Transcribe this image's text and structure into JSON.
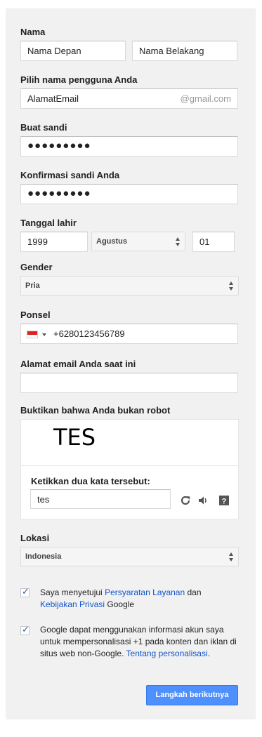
{
  "name": {
    "label": "Nama",
    "first_name": "Nama Depan",
    "last_name": "Nama Belakang"
  },
  "username": {
    "label": "Pilih nama pengguna Anda",
    "value": "AlamatEmail",
    "suffix": "@gmail.com"
  },
  "password": {
    "label": "Buat sandi",
    "value": "●●●●●●●●●"
  },
  "confirm_password": {
    "label": "Konfirmasi sandi Anda",
    "value": "●●●●●●●●●"
  },
  "birthday": {
    "label": "Tanggal lahir",
    "year": "1999",
    "month": "Agustus",
    "day": "01"
  },
  "gender": {
    "label": "Gender",
    "value": "Pria"
  },
  "phone": {
    "label": "Ponsel",
    "value": "+6280123456789"
  },
  "current_email": {
    "label": "Alamat email Anda saat ini",
    "value": ""
  },
  "captcha": {
    "label": "Buktikan bahwa Anda bukan robot",
    "word": "TES",
    "prompt": "Ketikkan dua kata tersebut:",
    "input_value": "tes"
  },
  "location": {
    "label": "Lokasi",
    "value": "Indonesia"
  },
  "terms": {
    "text_before": "Saya menyetujui ",
    "tos_link": "Persyaratan Layanan",
    "text_middle": " dan ",
    "privacy_link": "Kebijakan Privasi",
    "text_after": " Google"
  },
  "personalize": {
    "text": "Google dapat menggunakan informasi akun saya untuk mempersonalisasi +1 pada konten dan iklan di situs web non-Google. ",
    "link": "Tentang personalisasi",
    "text_after": "."
  },
  "next_button": "Langkah berikutnya",
  "colors": {
    "panel_bg": "#f1f1f1",
    "link": "#1155cc",
    "button_bg": "#4d90fe",
    "checkbox_tick": "#2a5db0"
  }
}
